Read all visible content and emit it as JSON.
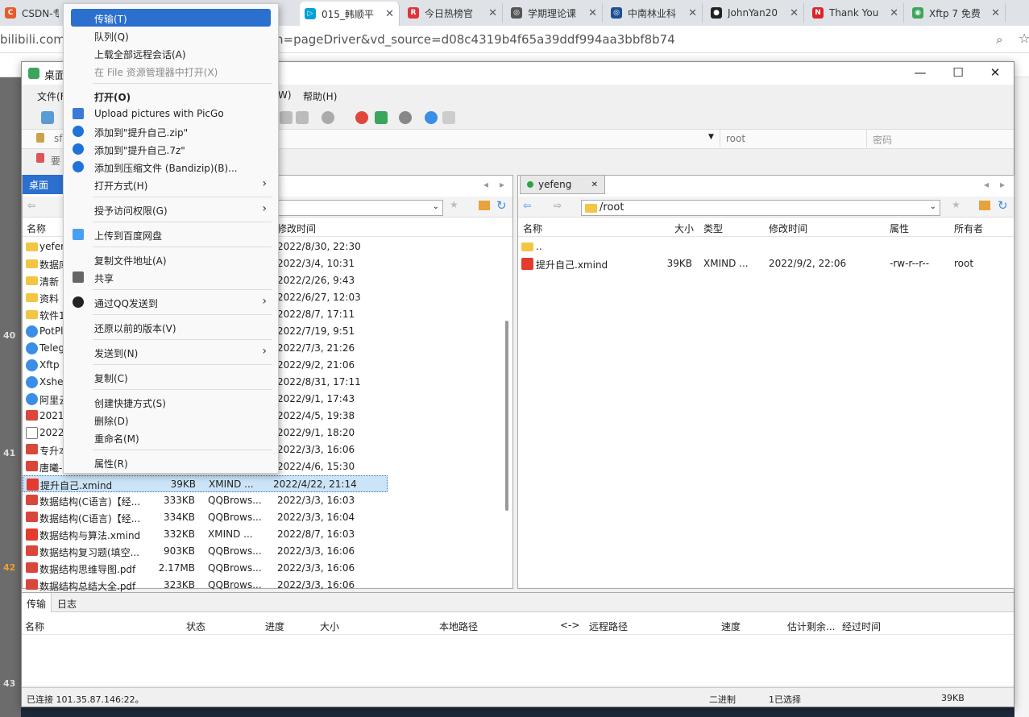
{
  "browser_tabs": [
    {
      "title": "CSDN-专业",
      "color": "#e85a2c",
      "glyph": "C"
    },
    {
      "title": "015_韩顺平",
      "color": "#00a1d6",
      "glyph": "▷"
    },
    {
      "title": "今日热榜官",
      "color": "#e0323a",
      "glyph": "R"
    },
    {
      "title": "学期理论课",
      "color": "#555555",
      "glyph": "◎"
    },
    {
      "title": "中南林业科",
      "color": "#1d4f91",
      "glyph": "◎"
    },
    {
      "title": "JohnYan20",
      "color": "#222222",
      "glyph": "●"
    },
    {
      "title": "Thank You",
      "color": "#d7262c",
      "glyph": "N"
    },
    {
      "title": "Xftp 7 免费",
      "color": "#3ba55c",
      "glyph": "◉"
    }
  ],
  "address": {
    "left": "bilibili.com/v",
    "right": "n=pageDriver&vd_source=d08c4319b4f65a39ddf994aa3bbf8b74"
  },
  "window": {
    "title": "桌面"
  },
  "menubar": [
    "文件(F)",
    "W)",
    "帮助(H)"
  ],
  "address_fields": {
    "host": "sf",
    "user": "root",
    "password_placeholder": "密码"
  },
  "hint": "要",
  "left_pane": {
    "tab": "桌面",
    "columns": [
      "名称",
      "修改时间"
    ],
    "rows": [
      {
        "name": "yefen",
        "icon": "folder",
        "size": "",
        "type": "",
        "mtime": "2022/8/30, 22:30"
      },
      {
        "name": "数据库",
        "icon": "folder",
        "size": "",
        "type": "",
        "mtime": "2022/3/4, 10:31"
      },
      {
        "name": "清新",
        "icon": "folder",
        "size": "",
        "type": "",
        "mtime": "2022/2/26, 9:43"
      },
      {
        "name": "资料",
        "icon": "folder",
        "size": "",
        "type": "",
        "mtime": "2022/6/27, 12:03"
      },
      {
        "name": "软件1",
        "icon": "folder",
        "size": "",
        "type": "",
        "mtime": "2022/8/7, 17:11"
      },
      {
        "name": "PotPl",
        "icon": "app",
        "size": "",
        "type": "",
        "mtime": "2022/7/19, 9:51"
      },
      {
        "name": "Teleg",
        "icon": "app",
        "size": "",
        "type": "",
        "mtime": "2022/7/3, 21:26"
      },
      {
        "name": "Xftp",
        "icon": "app",
        "size": "",
        "type": "",
        "mtime": "2022/9/2, 21:06"
      },
      {
        "name": "Xshe",
        "icon": "app",
        "size": "",
        "type": "",
        "mtime": "2022/8/31, 17:11"
      },
      {
        "name": "阿里云",
        "icon": "app",
        "size": "",
        "type": "",
        "mtime": "2022/9/1, 17:43"
      },
      {
        "name": "2021",
        "icon": "pdf",
        "size": "",
        "type": "",
        "mtime": "2022/4/5, 19:38"
      },
      {
        "name": "2022_",
        "icon": "doc",
        "size": "",
        "type": "",
        "mtime": "2022/9/1, 18:20"
      },
      {
        "name": "专升本",
        "icon": "pdf",
        "size": "",
        "type": "",
        "mtime": "2022/3/3, 16:06"
      },
      {
        "name": "唐曦-",
        "icon": "pdf",
        "size": "",
        "type": "",
        "mtime": "2022/4/6, 15:30"
      },
      {
        "name": "提升自己.xmind",
        "icon": "xmind",
        "size": "39KB",
        "type": "XMIND ...",
        "mtime": "2022/4/22, 21:14",
        "selected": true
      },
      {
        "name": "数据结构(C语言)【经...",
        "icon": "pdf",
        "size": "333KB",
        "type": "QQBrows...",
        "mtime": "2022/3/3, 16:03"
      },
      {
        "name": "数据结构(C语言)【经...",
        "icon": "pdf",
        "size": "334KB",
        "type": "QQBrows...",
        "mtime": "2022/3/3, 16:04"
      },
      {
        "name": "数据结构与算法.xmind",
        "icon": "xmind",
        "size": "332KB",
        "type": "XMIND ...",
        "mtime": "2022/8/7, 16:03"
      },
      {
        "name": "数据结构复习题(填空...",
        "icon": "pdf",
        "size": "903KB",
        "type": "QQBrows...",
        "mtime": "2022/3/3, 16:06"
      },
      {
        "name": "数据结构思维导图.pdf",
        "icon": "pdf",
        "size": "2.17MB",
        "type": "QQBrows...",
        "mtime": "2022/3/3, 16:06"
      },
      {
        "name": "数据结构总结大全.pdf",
        "icon": "pdf",
        "size": "323KB",
        "type": "QQBrows...",
        "mtime": "2022/3/3, 16:06"
      }
    ]
  },
  "right_pane": {
    "tab": "yefeng",
    "path": "/root",
    "columns": [
      "名称",
      "大小",
      "类型",
      "修改时间",
      "属性",
      "所有者"
    ],
    "rows": [
      {
        "name": "..",
        "icon": "folder",
        "size": "",
        "type": "",
        "mtime": "",
        "attr": "",
        "owner": ""
      },
      {
        "name": "提升自己.xmind",
        "icon": "xmind",
        "size": "39KB",
        "type": "XMIND ...",
        "mtime": "2022/9/2, 22:06",
        "attr": "-rw-r--r--",
        "owner": "root"
      }
    ]
  },
  "transfer": {
    "tabs": [
      "传输",
      "日志"
    ],
    "columns": [
      "名称",
      "状态",
      "进度",
      "大小",
      "本地路径",
      "<->",
      "远程路径",
      "速度",
      "估计剩余...",
      "经过时间"
    ]
  },
  "status": {
    "connection": "已连接 101.35.87.146:22。",
    "mode": "二进制",
    "selection": "1已选择",
    "size": "39KB"
  },
  "context_menu": [
    {
      "label": "传输(T)",
      "highlight": true
    },
    {
      "label": "队列(Q)"
    },
    {
      "label": "上载全部远程会话(A)"
    },
    {
      "label": "在 File 资源管理器中打开(X)",
      "disabled": true
    },
    {
      "sep": true
    },
    {
      "label": "打开(O)",
      "bold": true
    },
    {
      "label": "Upload pictures with PicGo",
      "icon": "picgo-icon"
    },
    {
      "label": "添加到\"提升自己.zip\"",
      "icon": "bandizip-icon"
    },
    {
      "label": "添加到\"提升自己.7z\"",
      "icon": "bandizip-icon"
    },
    {
      "label": "添加到压缩文件 (Bandizip)(B)...",
      "icon": "bandizip-icon"
    },
    {
      "label": "打开方式(H)",
      "submenu": true
    },
    {
      "sep": true
    },
    {
      "label": "授予访问权限(G)",
      "submenu": true
    },
    {
      "sep": true
    },
    {
      "label": "上传到百度网盘",
      "icon": "baidu-icon"
    },
    {
      "sep": true
    },
    {
      "label": "复制文件地址(A)"
    },
    {
      "label": "共享",
      "icon": "share-icon"
    },
    {
      "sep": true
    },
    {
      "label": "通过QQ发送到",
      "icon": "qq-icon",
      "submenu": true
    },
    {
      "sep": true
    },
    {
      "label": "还原以前的版本(V)"
    },
    {
      "sep": true
    },
    {
      "label": "发送到(N)",
      "submenu": true
    },
    {
      "sep": true
    },
    {
      "label": "复制(C)"
    },
    {
      "sep": true
    },
    {
      "label": "创建快捷方式(S)"
    },
    {
      "label": "删除(D)"
    },
    {
      "label": "重命名(M)"
    },
    {
      "sep": true
    },
    {
      "label": "属性(R)"
    }
  ],
  "side_numbers": [
    "40",
    "41",
    "42",
    "43"
  ]
}
